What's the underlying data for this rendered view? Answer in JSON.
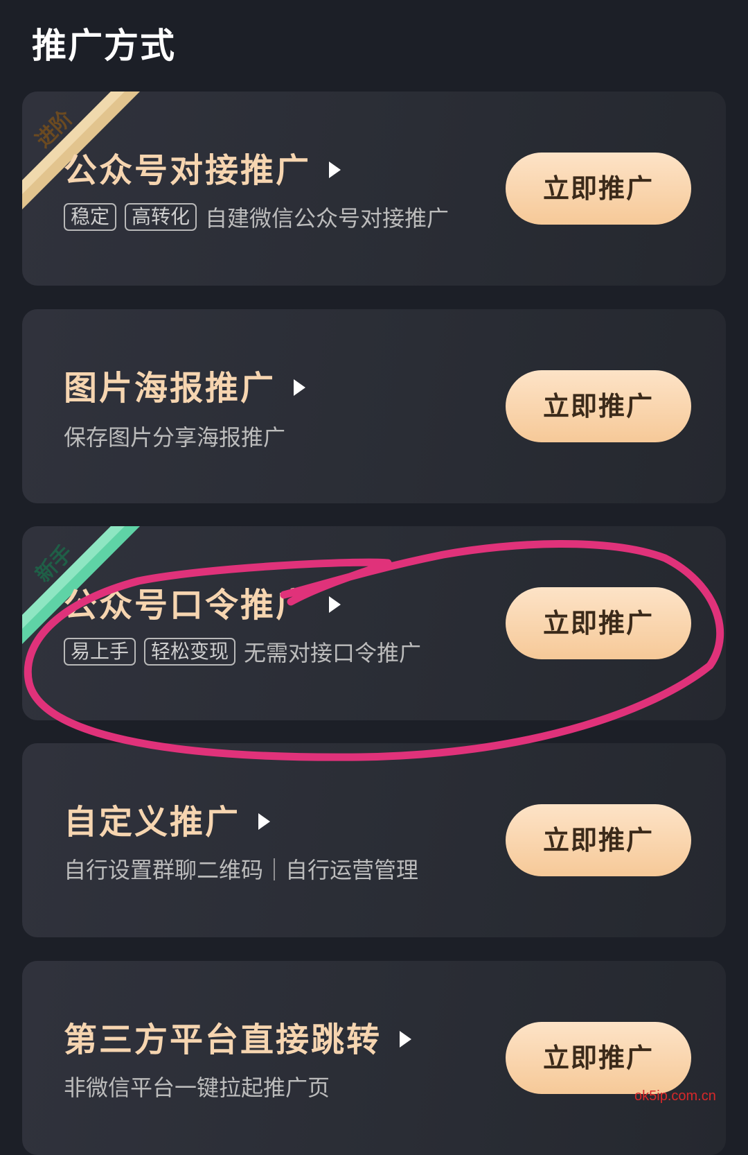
{
  "page": {
    "title": "推广方式"
  },
  "cards": [
    {
      "title": "公众号对接推广",
      "ribbon": "进阶",
      "tags": [
        "稳定",
        "高转化"
      ],
      "desc": "自建微信公众号对接推广",
      "button": "立即推广"
    },
    {
      "title": "图片海报推广",
      "desc": "保存图片分享海报推广",
      "button": "立即推广"
    },
    {
      "title": "公众号口令推广",
      "ribbon": "新手",
      "tags": [
        "易上手",
        "轻松变现"
      ],
      "desc": "无需对接口令推广",
      "button": "立即推广"
    },
    {
      "title": "自定义推广",
      "desc": "自行设置群聊二维码｜自行运营管理",
      "button": "立即推广"
    },
    {
      "title": "第三方平台直接跳转",
      "desc": "非微信平台一键拉起推广页",
      "button": "立即推广"
    }
  ],
  "icons": {
    "arrow": "play-arrow-icon",
    "ribbon_gold_color": "#e2c48e",
    "ribbon_green_color": "#5fd3a6",
    "annotation_color": "#e0327a"
  },
  "watermark": "ok5ip.com.cn"
}
